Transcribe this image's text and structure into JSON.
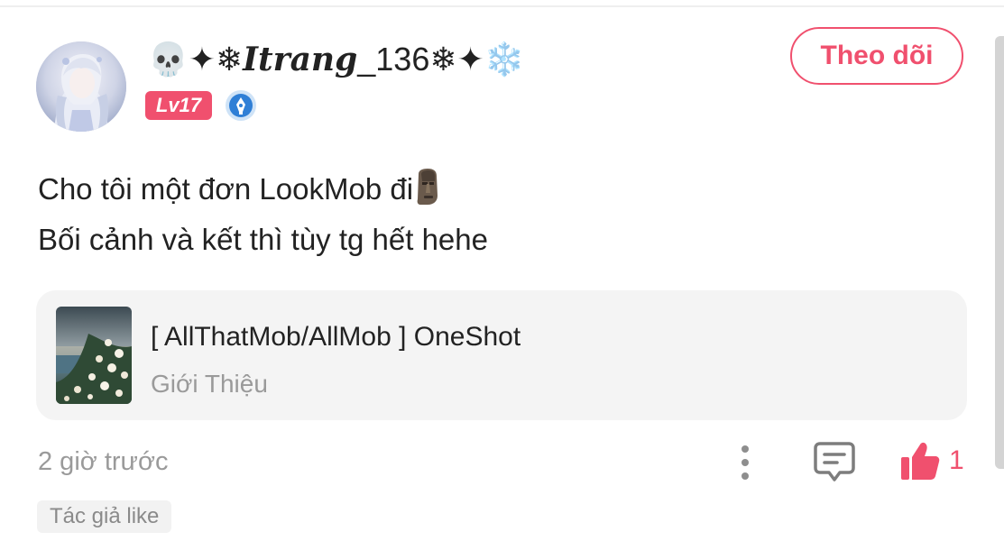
{
  "post": {
    "author": {
      "name_prefix": "💀✦❄",
      "name_script": "Itrang",
      "name_suffix": "_136❄✦❄️",
      "level": "Lv17",
      "avatar_icon": "anime-girl-avatar",
      "verified_icon": "blue-pen-badge-icon"
    },
    "follow_label": "Theo dõi",
    "body": {
      "line1": "Cho tôi một đơn LookMob đi",
      "line1_emoji": "moai-icon",
      "line2": "Bối cảnh và kết thì tùy tg hết hehe"
    },
    "story": {
      "title": "[ AllThatMob/AllMob ] OneShot",
      "subtitle": "Giới Thiệu",
      "cover_icon": "flowers-by-sea-cover"
    },
    "timestamp": "2 giờ trước",
    "like_count": "1",
    "author_liked": "Tác giả like"
  },
  "colors": {
    "accent": "#f0506e",
    "muted_text": "#9a9a9a",
    "card_bg": "#f4f4f4",
    "verified_blue": "#2f7fd6"
  }
}
